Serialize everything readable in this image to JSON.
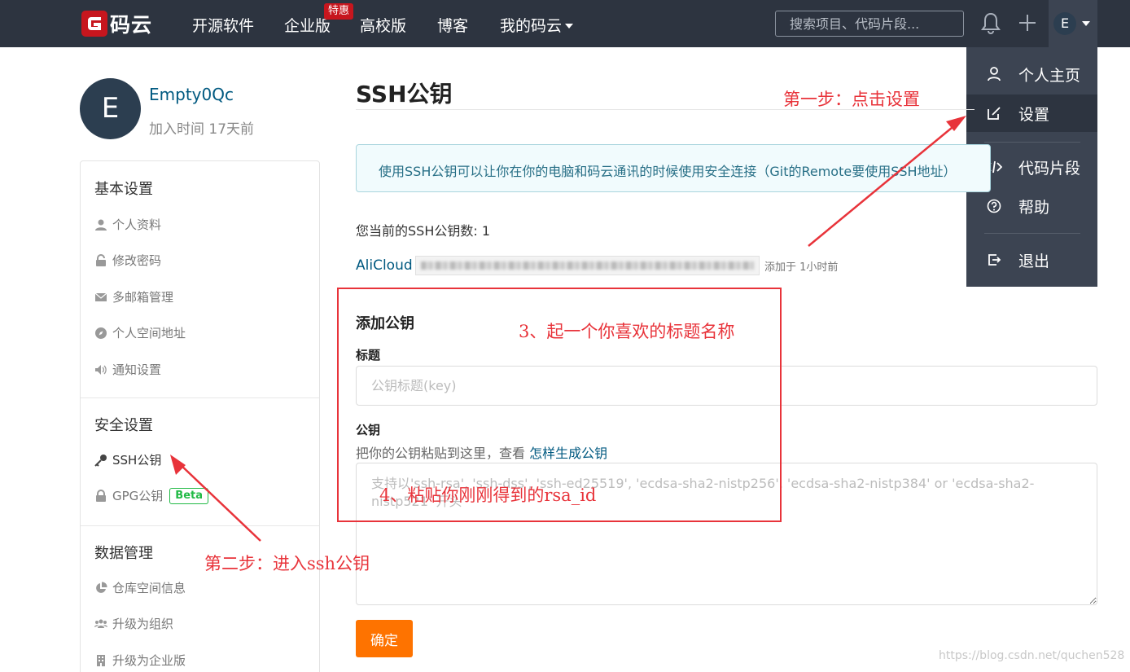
{
  "navbar": {
    "logo_text": "码云",
    "items": [
      "开源软件",
      "企业版",
      "高校版",
      "博客",
      "我的码云"
    ],
    "hot_badge": "特惠",
    "search_placeholder": "搜索项目、代码片段...",
    "avatar_letter": "E"
  },
  "dropdown": {
    "items": [
      "个人主页",
      "设置",
      "代码片段",
      "帮助",
      "退出"
    ],
    "active": "设置"
  },
  "profile": {
    "avatar_letter": "E",
    "username": "Empty0Qc",
    "join_time": "加入时间 17天前"
  },
  "sidebar": {
    "sections": [
      {
        "title": "基本设置",
        "items": [
          "个人资料",
          "修改密码",
          "多邮箱管理",
          "个人空间地址",
          "通知设置"
        ]
      },
      {
        "title": "安全设置",
        "items": [
          "SSH公钥",
          "GPG公钥"
        ]
      },
      {
        "title": "数据管理",
        "items": [
          "仓库空间信息",
          "升级为组织",
          "升级为企业版"
        ]
      }
    ],
    "beta_label": "Beta"
  },
  "main": {
    "title": "SSH公钥",
    "info": "使用SSH公钥可以让你在你的电脑和码云通讯的时候使用安全连接（Git的Remote要使用SSH地址）",
    "key_count": "您当前的SSH公钥数: 1",
    "key": {
      "name": "AliCloud",
      "added": "添加于 1小时前"
    },
    "form": {
      "heading": "添加公钥",
      "title_label": "标题",
      "title_placeholder": "公钥标题(key)",
      "key_label": "公钥",
      "hint_prefix": "把你的公钥粘贴到这里，查看",
      "hint_link": "怎样生成公钥",
      "key_placeholder": "支持以'ssh-rsa', 'ssh-dss', 'ssh-ed25519', 'ecdsa-sha2-nistp256', 'ecdsa-sha2-nistp384' or 'ecdsa-sha2-nistp521' 开头",
      "submit": "确定"
    }
  },
  "annotations": {
    "step1": "第一步：点击设置",
    "step2": "第二步：进入ssh公钥",
    "step3": "3、起一个你喜欢的标题名称",
    "step4": "4、粘贴你刚刚得到的rsa_id",
    "color": "#e8333a"
  },
  "watermark": "https://blog.csdn.net/quchen528",
  "colors": {
    "navbar": "#2d3440",
    "accent": "#fe7300",
    "link": "#005980"
  }
}
